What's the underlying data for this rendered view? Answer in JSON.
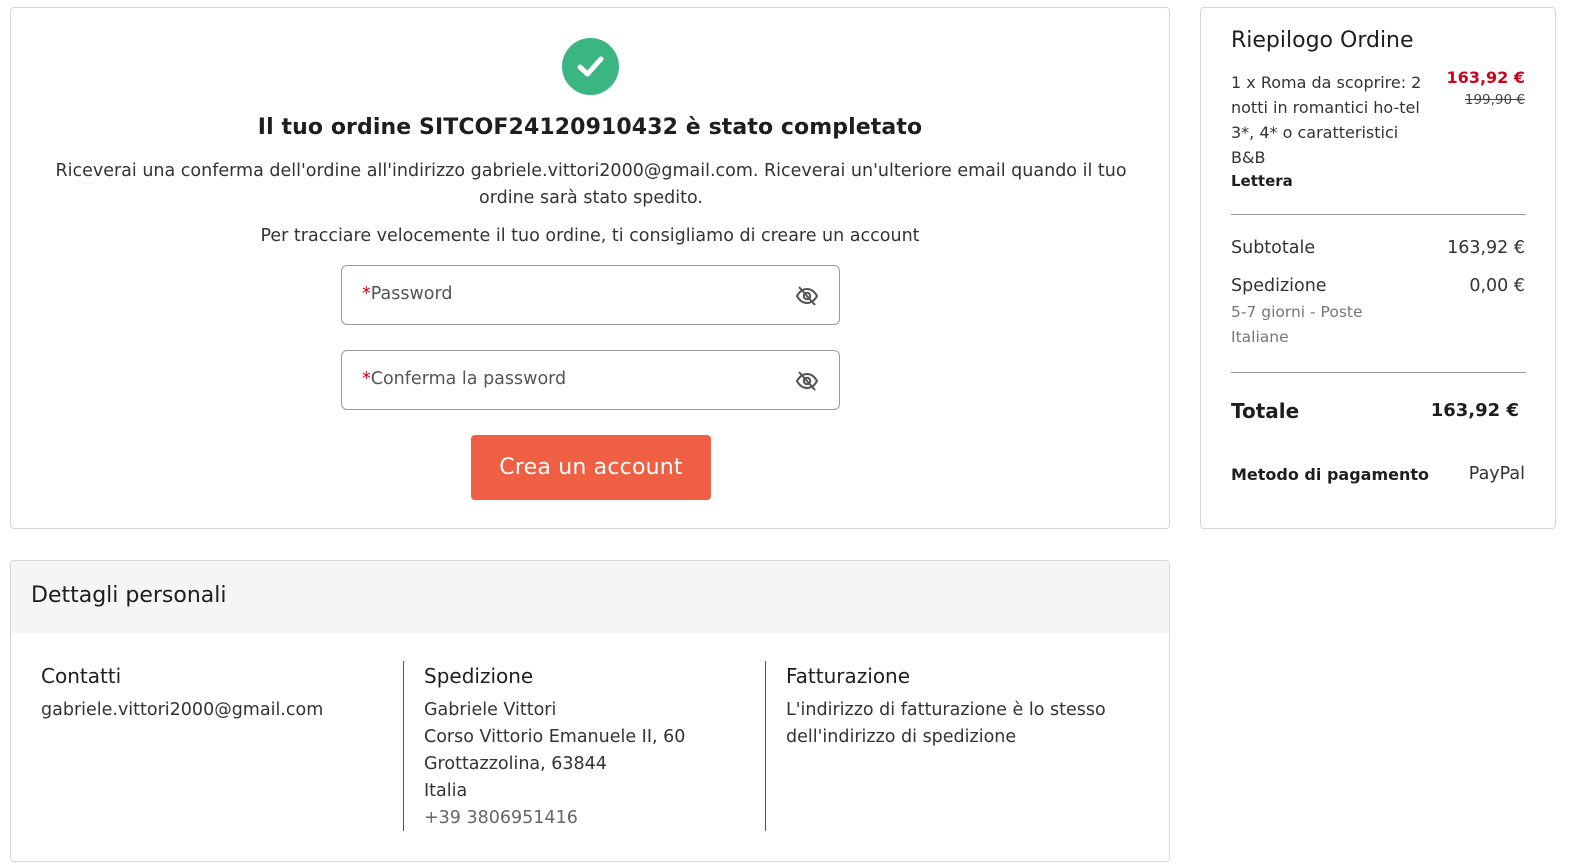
{
  "confirmation": {
    "icon": "check-icon",
    "accent_color": "#3bb582",
    "title": "Il tuo ordine SITCOF24120910432 è stato completato",
    "message": "Riceverai una conferma dell'ordine all'indirizzo gabriele.vittori2000@gmail.com. Riceverai un'ulteriore email quando il tuo ordine sarà stato spedito.",
    "advice": "Per tracciare velocemente il tuo ordine, ti consigliamo di creare un account",
    "password_field": {
      "required_mark": "*",
      "placeholder": "Password",
      "icon": "eye-off-icon"
    },
    "confirm_password_field": {
      "required_mark": "*",
      "placeholder": "Conferma la password",
      "icon": "eye-off-icon"
    },
    "create_account_label": "Crea un account",
    "button_color": "#ee5f43"
  },
  "summary": {
    "title": "Riepilogo Ordine",
    "item": {
      "description": "1 x Roma da scoprire: 2 notti in romantici ho-tel 3*, 4* o caratteristici B&B",
      "variant": "Lettera",
      "price": "163,92 €",
      "old_price": "199,90 €",
      "price_color": "#d0021b"
    },
    "subtotal_label": "Subtotale",
    "subtotal_value": "163,92 €",
    "shipping_label": "Spedizione",
    "shipping_value": "0,00 €",
    "shipping_note": "5-7 giorni - Poste Italiane",
    "total_label": "Totale",
    "total_value": "163,92 €",
    "payment_label": "Metodo di pagamento",
    "payment_value": "PayPal"
  },
  "details": {
    "title": "Dettagli personali",
    "contacts": {
      "title": "Contatti",
      "email": "gabriele.vittori2000@gmail.com"
    },
    "shipping": {
      "title": "Spedizione",
      "name": "Gabriele Vittori",
      "street": "Corso Vittorio Emanuele II, 60",
      "city": "Grottazzolina, 63844",
      "country": "Italia",
      "phone": "+39 3806951416"
    },
    "billing": {
      "title": "Fatturazione",
      "text": "L'indirizzo di fatturazione è lo stesso dell'indirizzo di spedizione"
    }
  }
}
